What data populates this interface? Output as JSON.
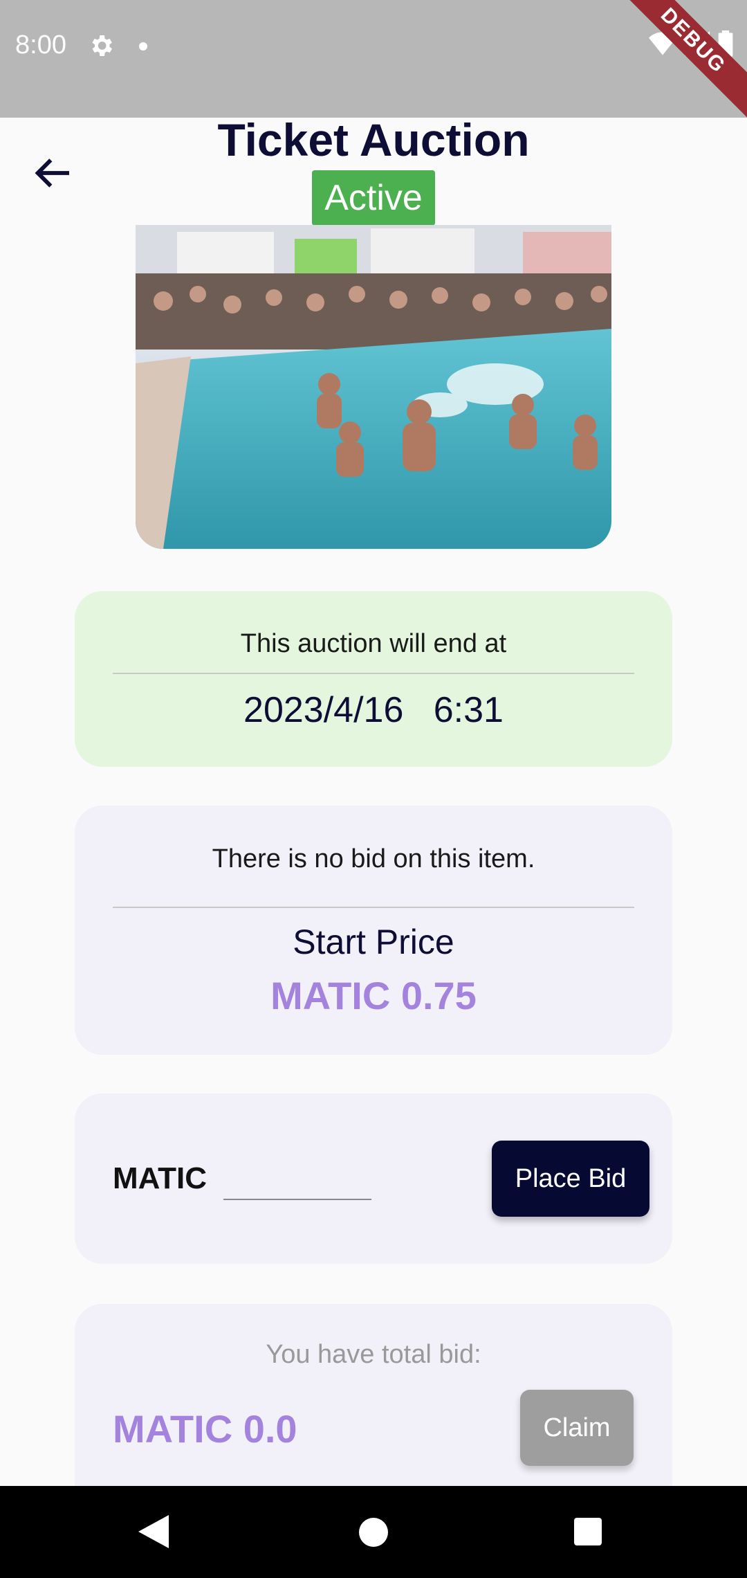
{
  "status_bar": {
    "time": "8:00",
    "debug_label": "DEBUG"
  },
  "header": {
    "title": "Ticket Auction",
    "status": "Active",
    "status_color": "#4caf50"
  },
  "event_image": {
    "description_icon": "pool-party-image"
  },
  "end_card": {
    "label": "This auction will end at",
    "date": "2023/4/16",
    "time": "6:31",
    "bg_color": "#e4f6de"
  },
  "bid_status_card": {
    "message": "There is no bid on this item.",
    "start_price_label": "Start Price",
    "start_price": "MATIC  0.75",
    "price_color": "#a383de"
  },
  "place_bid_card": {
    "currency": "MATIC",
    "input_value": "",
    "button_label": "Place Bid"
  },
  "total_bid_card": {
    "label": "You have total bid:",
    "amount": "MATIC  0.0",
    "claim_label": "Claim"
  }
}
